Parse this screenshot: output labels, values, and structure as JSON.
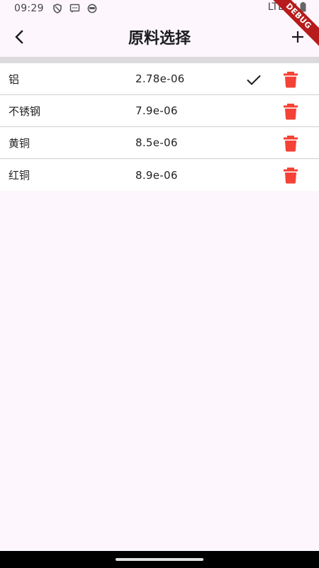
{
  "status_bar": {
    "time": "09:29",
    "network": "LTE",
    "icons": [
      "shield-icon",
      "message-icon",
      "face-icon",
      "signal-icon",
      "battery-icon"
    ]
  },
  "debug_banner": {
    "label": "DEBUG"
  },
  "app_bar": {
    "title": "原料选择",
    "back_icon": "chevron-left-icon",
    "add_icon": "plus-icon"
  },
  "materials": [
    {
      "name": "铝",
      "value": "2.78e-06",
      "selected": true
    },
    {
      "name": "不锈钢",
      "value": "7.9e-06",
      "selected": false
    },
    {
      "name": "黄铜",
      "value": "8.5e-06",
      "selected": false
    },
    {
      "name": "红铜",
      "value": "8.9e-06",
      "selected": false
    }
  ],
  "colors": {
    "delete": "#f44336",
    "background": "#fdf7fd",
    "divider_band": "#dcdadd"
  }
}
